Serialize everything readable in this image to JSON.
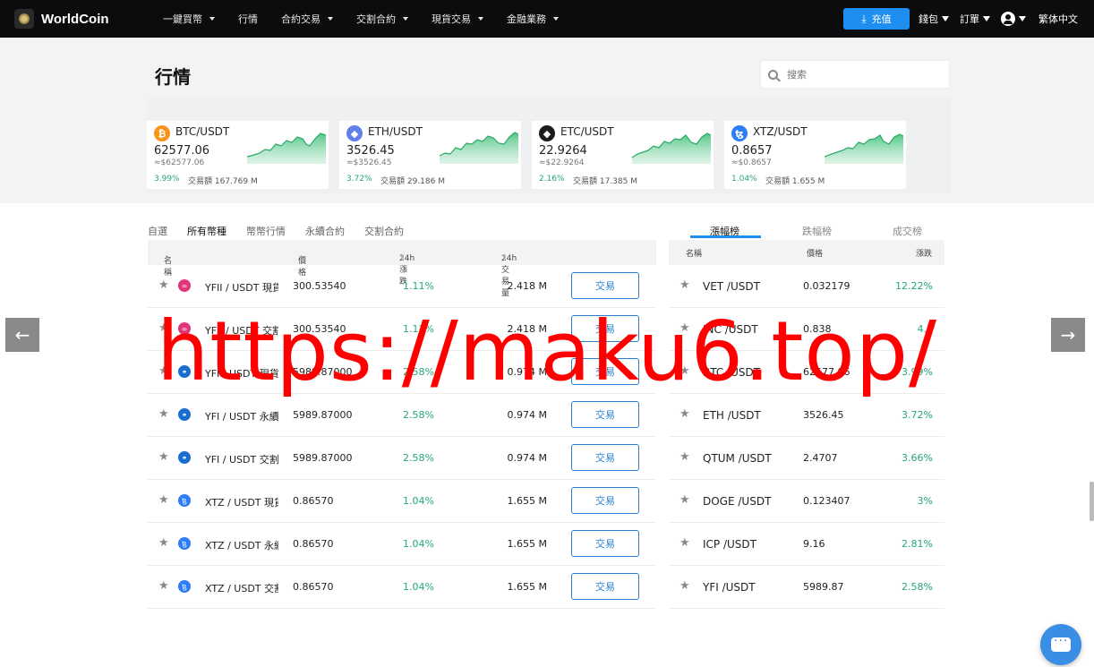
{
  "header": {
    "brand": "WorldCoin",
    "nav": [
      "一鍵買幣",
      "行情",
      "合約交易",
      "交割合約",
      "現貨交易",
      "金融業務"
    ],
    "nav_has_caret": [
      true,
      false,
      true,
      true,
      true,
      true
    ],
    "deposit": "充值",
    "wallet": "錢包",
    "orders": "訂單",
    "language": "繁体中文"
  },
  "page": {
    "title": "行情",
    "search_placeholder": "搜索"
  },
  "tickers": [
    {
      "pair": "BTC/USDT",
      "price": "62577.06",
      "cny": "≈$62577.06",
      "change": "3.99%",
      "volume": "交易額 167.769 M",
      "coin": "₿",
      "color": "#f7931a"
    },
    {
      "pair": "ETH/USDT",
      "price": "3526.45",
      "cny": "≈$3526.45",
      "change": "3.72%",
      "volume": "交易額 29.186 M",
      "coin": "◆",
      "color": "#627eea"
    },
    {
      "pair": "ETC/USDT",
      "price": "22.9264",
      "cny": "≈$22.9264",
      "change": "2.16%",
      "volume": "交易額 17.385 M",
      "coin": "◆",
      "color": "#1b1b1b"
    },
    {
      "pair": "XTZ/USDT",
      "price": "0.8657",
      "cny": "≈$0.8657",
      "change": "1.04%",
      "volume": "交易額 1.655 M",
      "coin": "ꜩ",
      "color": "#2c7df7"
    }
  ],
  "tabs": [
    "自選",
    "所有幣種",
    "幣幣行情",
    "永續合約",
    "交割合約"
  ],
  "table": {
    "headers": {
      "name": "名稱",
      "price": "價格",
      "change": "24h漲跌",
      "volume": "24h交易量"
    },
    "trade_label": "交易",
    "rows": [
      {
        "pair": "YFII / USDT 現貨",
        "price": "300.53540",
        "change": "1.11%",
        "volume": "2.418 M",
        "icon": "yfii",
        "color": "#e0357a"
      },
      {
        "pair": "YFII / USDT 交割",
        "price": "300.53540",
        "change": "1.11%",
        "volume": "2.418 M",
        "icon": "yfii",
        "color": "#e0357a"
      },
      {
        "pair": "YFI / USDT 現貨",
        "price": "5989.87000",
        "change": "2.58%",
        "volume": "0.974 M",
        "icon": "yfi",
        "color": "#1a6dcf"
      },
      {
        "pair": "YFI / USDT 永續",
        "price": "5989.87000",
        "change": "2.58%",
        "volume": "0.974 M",
        "icon": "yfi",
        "color": "#1a6dcf"
      },
      {
        "pair": "YFI / USDT 交割",
        "price": "5989.87000",
        "change": "2.58%",
        "volume": "0.974 M",
        "icon": "yfi",
        "color": "#1a6dcf"
      },
      {
        "pair": "XTZ / USDT 現貨",
        "price": "0.86570",
        "change": "1.04%",
        "volume": "1.655 M",
        "icon": "xtz",
        "color": "#2c7df7"
      },
      {
        "pair": "XTZ / USDT 永續",
        "price": "0.86570",
        "change": "1.04%",
        "volume": "1.655 M",
        "icon": "xtz",
        "color": "#2c7df7"
      },
      {
        "pair": "XTZ / USDT 交割",
        "price": "0.86570",
        "change": "1.04%",
        "volume": "1.655 M",
        "icon": "xtz",
        "color": "#2c7df7"
      }
    ]
  },
  "ranking": {
    "tabs": [
      "漲幅榜",
      "跌幅榜",
      "成交榜"
    ],
    "headers": {
      "name": "名稱",
      "price": "價格",
      "change": "漲跌"
    },
    "rows": [
      {
        "name": "VET /USDT",
        "price": "0.032179",
        "change": "12.22%"
      },
      {
        "name": "INC /USDT",
        "price": "0.838",
        "change": "4.5"
      },
      {
        "name": "BTC /USDT",
        "price": "62577.06",
        "change": "3.99%"
      },
      {
        "name": "ETH /USDT",
        "price": "3526.45",
        "change": "3.72%"
      },
      {
        "name": "QTUM /USDT",
        "price": "2.4707",
        "change": "3.66%"
      },
      {
        "name": "DOGE /USDT",
        "price": "0.123407",
        "change": "3%"
      },
      {
        "name": "ICP /USDT",
        "price": "9.16",
        "change": "2.81%"
      },
      {
        "name": "YFI /USDT",
        "price": "5989.87",
        "change": "2.58%"
      }
    ]
  },
  "watermark": "https://maku6.top/",
  "colors": {
    "accent": "#1e8ef0",
    "up": "#23a878",
    "header_bg": "#0c0c0e",
    "watermark": "#ff0000"
  }
}
